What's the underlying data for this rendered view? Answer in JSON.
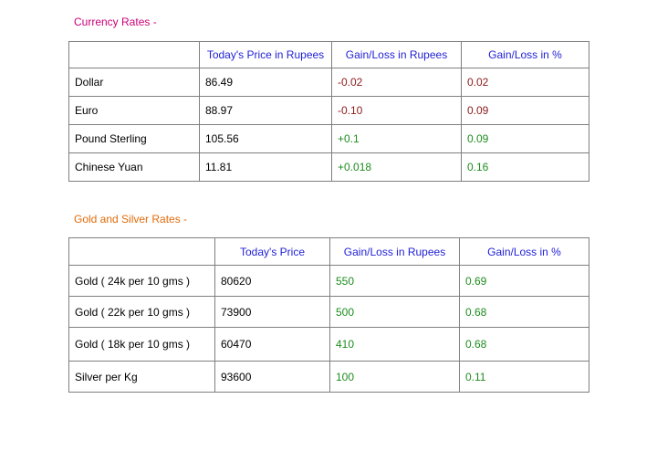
{
  "currency": {
    "heading": "Currency Rates -",
    "headers": [
      "",
      "Today's Price in Rupees",
      "Gain/Loss in Rupees",
      "Gain/Loss in %"
    ],
    "rows": [
      {
        "name": "Dollar",
        "price": "86.49",
        "gain": "-0.02",
        "pct": "0.02"
      },
      {
        "name": "Euro",
        "price": "88.97",
        "gain": "-0.10",
        "pct": "0.09"
      },
      {
        "name": "Pound Sterling",
        "price": "105.56",
        "gain": "+0.1",
        "pct": "0.09"
      },
      {
        "name": "Chinese Yuan",
        "price": "11.81",
        "gain": "+0.018",
        "pct": "0.16"
      }
    ]
  },
  "metals": {
    "heading": "Gold and Silver Rates -",
    "headers": [
      "",
      "Today's Price",
      "Gain/Loss in Rupees",
      "Gain/Loss in %"
    ],
    "rows": [
      {
        "name": "Gold ( 24k per 10 gms )",
        "price": "80620",
        "gain": "550",
        "pct": "0.69"
      },
      {
        "name": "Gold ( 22k per 10 gms )",
        "price": "73900",
        "gain": "500",
        "pct": "0.68"
      },
      {
        "name": "Gold ( 18k per 10 gms )",
        "price": "60470",
        "gain": "410",
        "pct": "0.68"
      },
      {
        "name": "Silver per Kg",
        "price": "93600",
        "gain": "100",
        "pct": "0.11"
      }
    ]
  },
  "colors": {
    "currency_heading": "#cc0077",
    "metals_heading": "#e36c0a",
    "header_text": "#1f1fd6",
    "loss": "#8b1a1a",
    "gain": "#1e8c1e"
  }
}
